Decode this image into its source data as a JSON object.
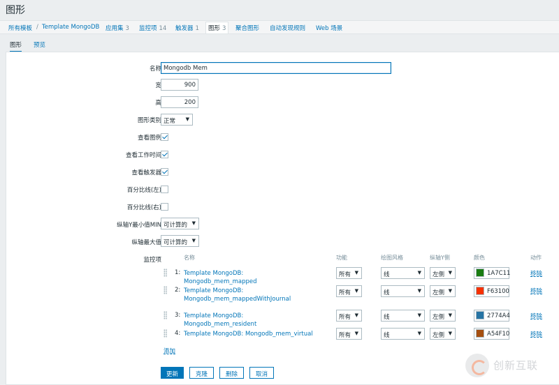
{
  "page": {
    "title": "图形"
  },
  "breadcrumb": {
    "all_templates": "所有模板",
    "template": "Template MongoDB",
    "items": [
      {
        "label": "应用集",
        "count": "3"
      },
      {
        "label": "监控项",
        "count": "14"
      },
      {
        "label": "触发器",
        "count": "1"
      },
      {
        "label": "图形",
        "count": "3"
      }
    ],
    "aggregate_graphs": "聚合图形",
    "discovery_rules": "自动发现规则",
    "web_scenarios": "Web 场景"
  },
  "tabs": {
    "graph": "图形",
    "preview": "预览"
  },
  "form": {
    "name": {
      "label": "名称",
      "value": "Mongodb Mem"
    },
    "width": {
      "label": "宽",
      "value": "900"
    },
    "height": {
      "label": "高",
      "value": "200"
    },
    "graph_type": {
      "label": "图形类别",
      "value": "正常"
    },
    "show_legend": {
      "label": "查看图例",
      "checked": true
    },
    "show_working_time": {
      "label": "查看工作时间",
      "checked": true
    },
    "show_triggers": {
      "label": "查看触发器",
      "checked": true
    },
    "percentile_left": {
      "label": "百分比线(左)",
      "checked": false
    },
    "percentile_right": {
      "label": "百分比线(右)",
      "checked": false
    },
    "y_min": {
      "label": "纵轴Y最小值MIN",
      "value": "可计算的"
    },
    "y_max": {
      "label": "纵轴最大值",
      "value": "可计算的"
    },
    "items_label": "监控项"
  },
  "items_table": {
    "headers": {
      "name": "名称",
      "function": "功能",
      "draw_style": "绘图风格",
      "y_axis": "纵轴Y侧",
      "color": "颜色",
      "action": "动作"
    },
    "rows": [
      {
        "num": "1:",
        "name": "Template MongoDB: Mongodb_mem_mapped",
        "function": "所有",
        "draw_style": "线",
        "y_axis": "左侧",
        "color": "1A7C11",
        "color_hex": "#1A7C11",
        "action": "移除"
      },
      {
        "num": "2:",
        "name": "Template MongoDB: Mongodb_mem_mappedWithJournal",
        "function": "所有",
        "draw_style": "线",
        "y_axis": "左侧",
        "color": "F63100",
        "color_hex": "#F63100",
        "action": "移除"
      },
      {
        "num": "3:",
        "name": "Template MongoDB: Mongodb_mem_resident",
        "function": "所有",
        "draw_style": "线",
        "y_axis": "左侧",
        "color": "2774A4",
        "color_hex": "#2774A4",
        "action": "移除"
      },
      {
        "num": "4:",
        "name": "Template MongoDB: Mongodb_mem_virtual",
        "function": "所有",
        "draw_style": "线",
        "y_axis": "左侧",
        "color": "A54F10",
        "color_hex": "#A54F10",
        "action": "移除"
      }
    ],
    "add": "添加"
  },
  "buttons": {
    "update": "更新",
    "clone": "克隆",
    "delete": "删除",
    "cancel": "取消"
  },
  "watermark": {
    "text": "创新互联"
  }
}
